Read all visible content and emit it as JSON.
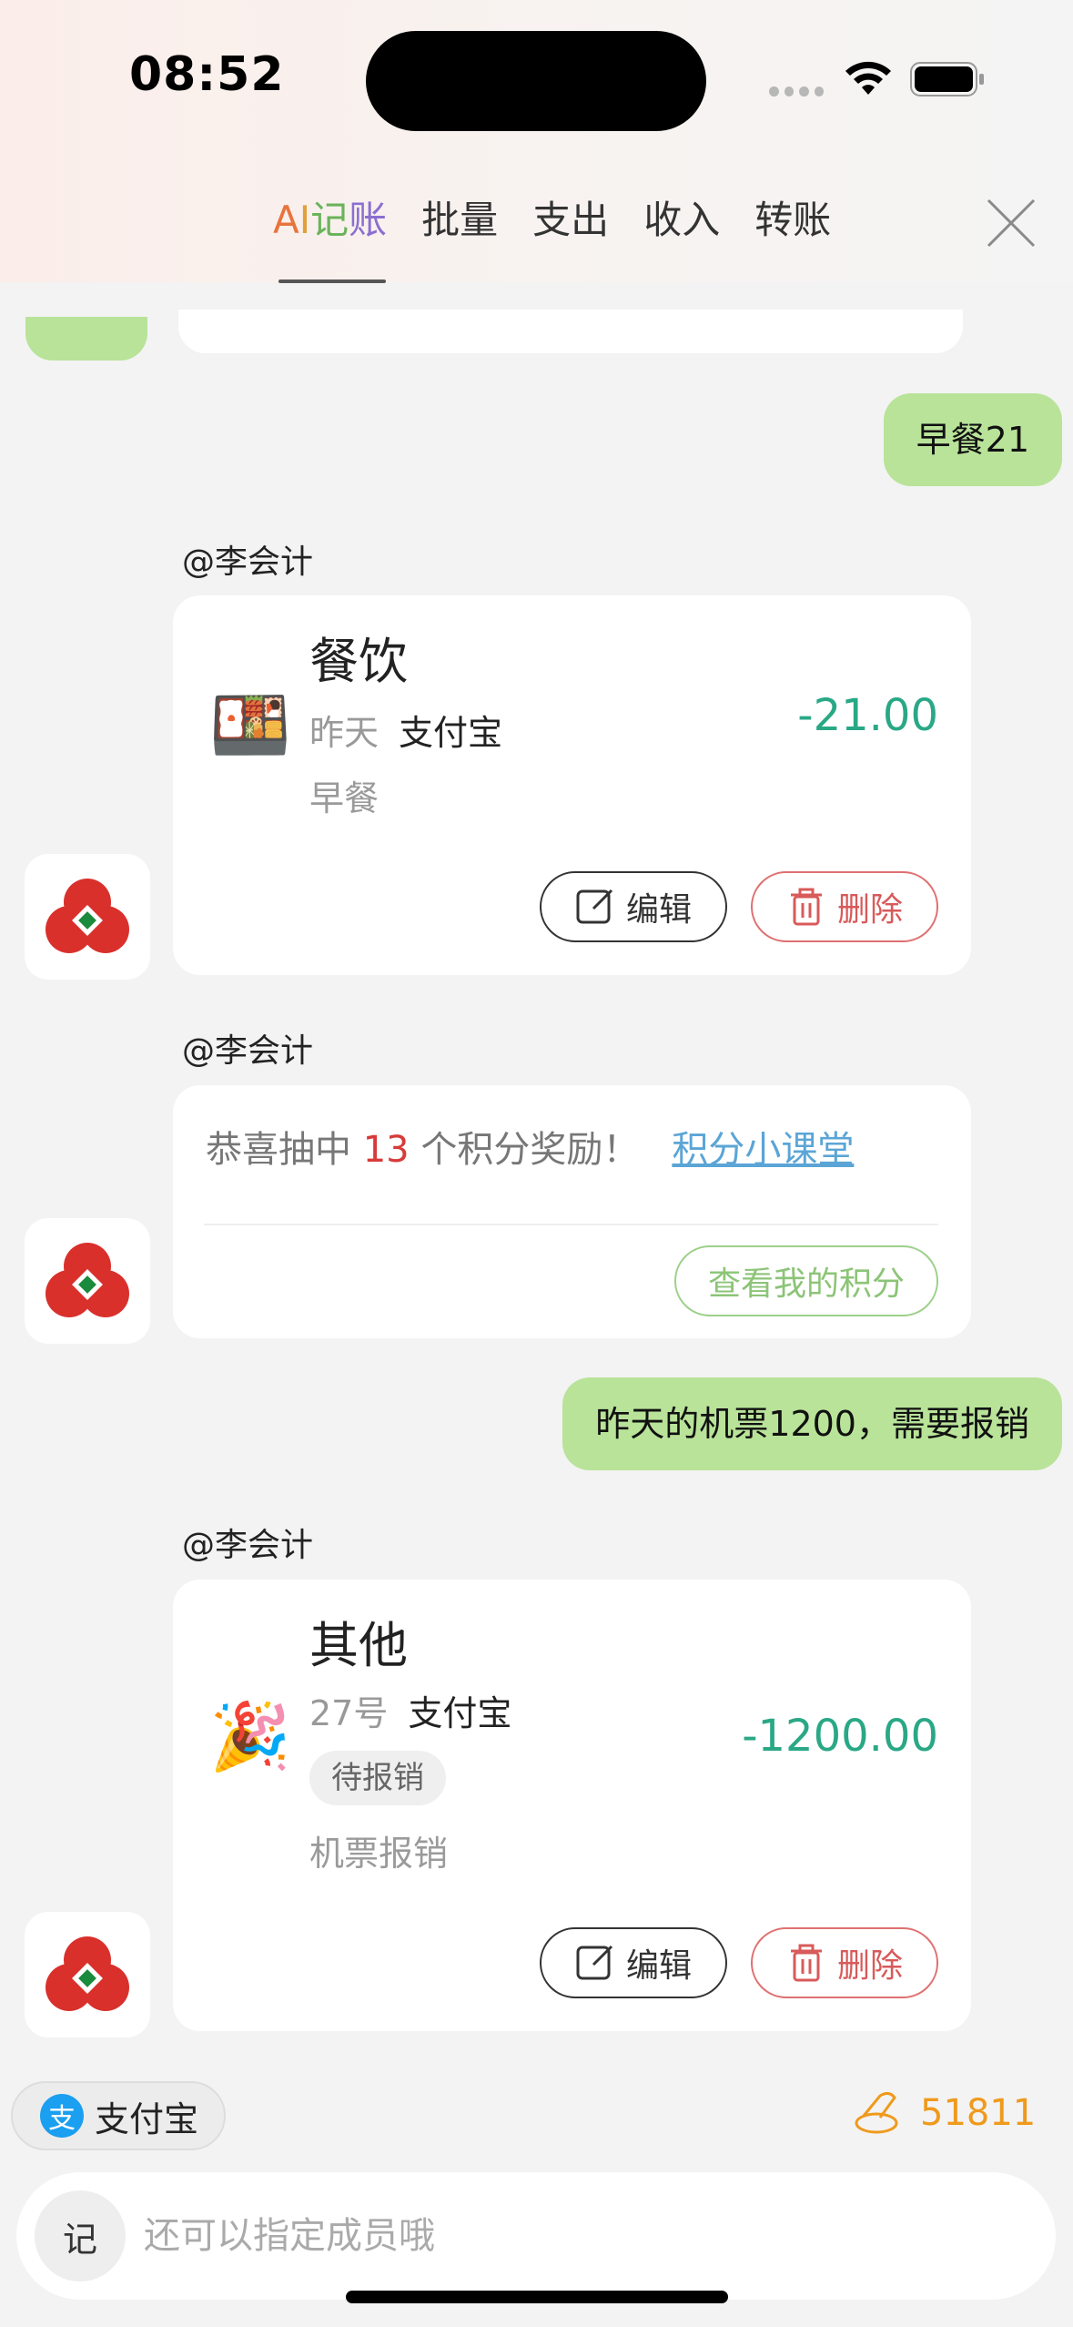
{
  "status_bar": {
    "time": "08:52"
  },
  "tabs": [
    {
      "id": "ai",
      "label_parts": [
        "A",
        "I",
        "记",
        "账"
      ],
      "active": true
    },
    {
      "id": "batch",
      "label": "批量"
    },
    {
      "id": "expense",
      "label": "支出"
    },
    {
      "id": "income",
      "label": "收入"
    },
    {
      "id": "transfer",
      "label": "转账"
    }
  ],
  "messages": {
    "user1": "早餐21",
    "sender1": "@李会计",
    "record1": {
      "category": "餐饮",
      "day": "昨天",
      "payment": "支付宝",
      "note": "早餐",
      "amount": "-21.00",
      "icon": "bento-icon",
      "edit_label": "编辑",
      "delete_label": "删除"
    },
    "sender2": "@李会计",
    "reward": {
      "prefix": "恭喜抽中",
      "count": "13",
      "suffix": "个积分奖励！",
      "link": "积分小课堂",
      "button": "查看我的积分"
    },
    "user2": "昨天的机票1200，需要报销",
    "sender3": "@李会计",
    "record2": {
      "category": "其他",
      "day": "27号",
      "payment": "支付宝",
      "tag": "待报销",
      "note": "机票报销",
      "amount": "-1200.00",
      "icon": "party-popper-icon",
      "edit_label": "编辑",
      "delete_label": "删除"
    }
  },
  "bottom": {
    "payment_chip": "支付宝",
    "alipay_logo_char": "支",
    "coins": "51811",
    "input_prefix": "记",
    "input_placeholder": "还可以指定成员哦"
  },
  "colors": {
    "user_bubble": "#b8e399",
    "amount": "#2aa886",
    "delete": "#d85a5a",
    "reward_number": "#d83a3a",
    "link": "#5ba5d6",
    "coins": "#ef9a1c"
  }
}
